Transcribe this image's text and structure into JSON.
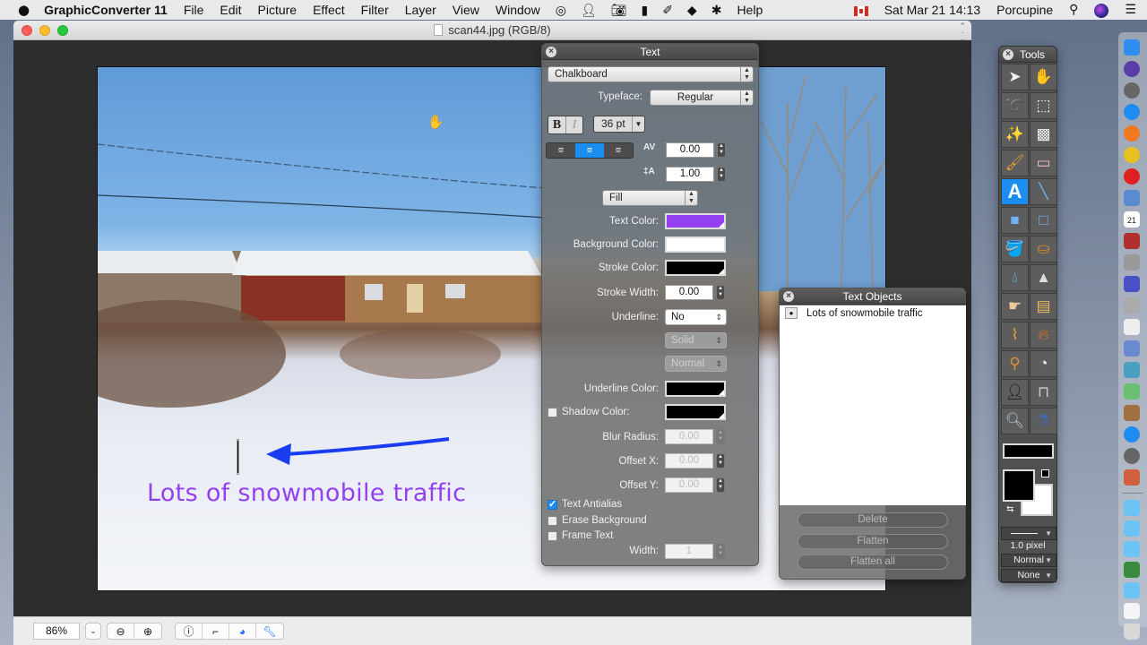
{
  "menubar": {
    "apple_icon": "apple-icon",
    "app_name": "GraphicConverter 11",
    "menus": [
      "File",
      "Edit",
      "Picture",
      "Effect",
      "Filter",
      "Layer",
      "View",
      "Window"
    ],
    "status_icons": [
      "target-icon",
      "user-silhouette-icon",
      "camera-icon",
      "clipboard-icon",
      "eyedropper-icon",
      "diamond-droplet-icon",
      "gear-icon"
    ],
    "help": "Help",
    "flag": "canada-flag-icon",
    "datetime": "Sat Mar 21  14:13",
    "user": "Porcupine"
  },
  "window": {
    "title": "scan44.jpg (RGB/8)"
  },
  "image": {
    "annotation_text": "Lots of snowmobile traffic",
    "annotation_color": "#9340f0",
    "arrow_color": "#1a3cf0"
  },
  "bottombar": {
    "zoom_value": "86%",
    "zoom_out": "⊖",
    "zoom_in": "⊕"
  },
  "text_panel": {
    "title": "Text",
    "font": "Chalkboard",
    "typeface_label": "Typeface:",
    "typeface": "Regular",
    "bold": "B",
    "italic": "I",
    "size": "36 pt",
    "alignment_selected": "center",
    "kerning": "0.00",
    "line_spacing": "1.00",
    "fill_mode": "Fill",
    "text_color_label": "Text Color:",
    "text_color": "#9340f0",
    "background_color_label": "Background Color:",
    "background_color": "#ffffff",
    "stroke_color_label": "Stroke Color:",
    "stroke_color": "#000000",
    "stroke_width_label": "Stroke Width:",
    "stroke_width": "0.00",
    "underline_label": "Underline:",
    "underline": "No",
    "underline_style": "Solid",
    "underline_weight": "Normal",
    "underline_color_label": "Underline Color:",
    "underline_color": "#000000",
    "shadow_color_label": "Shadow Color:",
    "shadow_color": "#000000",
    "shadow_enabled": false,
    "blur_radius_label": "Blur Radius:",
    "blur_radius": "0.00",
    "offset_x_label": "Offset X:",
    "offset_x": "0.00",
    "offset_y_label": "Offset Y:",
    "offset_y": "0.00",
    "antialias_label": "Text Antialias",
    "antialias": true,
    "erase_bg_label": "Erase Background",
    "erase_bg": false,
    "frame_text_label": "Frame Text",
    "frame_text": false,
    "width_label": "Width:",
    "width": "1"
  },
  "text_objects_panel": {
    "title": "Text Objects",
    "items": [
      {
        "label": "Lots of snowmobile traffic",
        "visible": true
      }
    ],
    "buttons": {
      "delete": "Delete",
      "flatten": "Flatten",
      "flatten_all": "Flatten all"
    }
  },
  "tools_panel": {
    "title": "Tools",
    "tools": [
      "arrow-select",
      "hand",
      "lasso",
      "rect-marquee",
      "magic-wand",
      "background-eraser-wand",
      "brush",
      "eraser",
      "text",
      "line",
      "filled-rect",
      "rect",
      "paint-bucket",
      "stamp",
      "blur-drop",
      "sharpen-cone",
      "smudge-finger",
      "sponge",
      "brush-tool",
      "burn-match",
      "eyedropper",
      "color-replace-dropper",
      "silhouette",
      "caliper-measure",
      "magnifier",
      "glue"
    ],
    "active_tool": "text",
    "foreground_color": "#000000",
    "background_color": "#ffffff",
    "line_width": "1.0 pixel",
    "blend_mode": "Normal",
    "arrow_style": "None"
  },
  "dock": {
    "apps": [
      "finder",
      "siri",
      "launchpad",
      "safari",
      "firefox",
      "chrome",
      "opera",
      "preview",
      "calendar",
      "dictionary",
      "calculator",
      "bbedit",
      "graphicconverter",
      "textedit",
      "photo-browser",
      "image-capture",
      "maps",
      "photos",
      "app-store",
      "system-preferences",
      "home-photo"
    ],
    "calendar_day": "21",
    "folders": [
      "folder",
      "folder",
      "folder",
      "pictures",
      "folder",
      "documents"
    ],
    "trash": "trash"
  }
}
